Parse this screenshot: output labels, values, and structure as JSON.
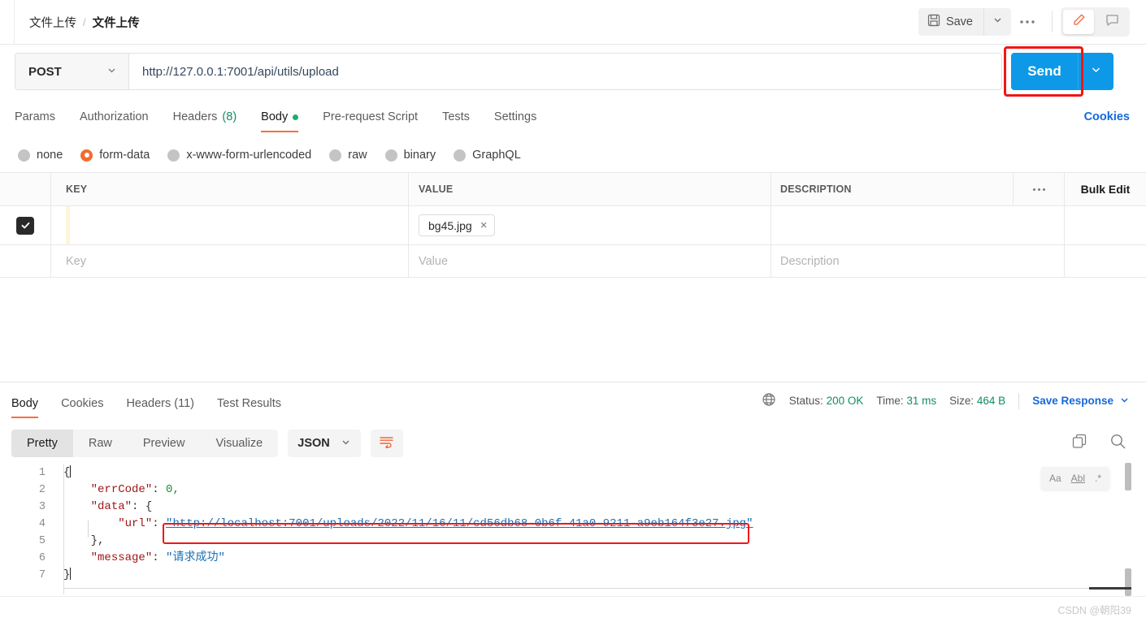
{
  "header": {
    "breadcrumb_parent": "文件上传",
    "breadcrumb_sep": "/",
    "breadcrumb_current": "文件上传",
    "save_label": "Save",
    "save_caret_icon": "chevron-down-icon",
    "save_icon": "floppy-disk-icon",
    "more_icon": "ooo",
    "edit_icon": "pencil-icon",
    "comment_icon": "comment-icon"
  },
  "request": {
    "method": "POST",
    "method_caret_icon": "chevron-down-icon",
    "url": "http://127.0.0.1:7001/api/utils/upload",
    "send_label": "Send",
    "send_caret_icon": "chevron-down-icon"
  },
  "request_tabs": [
    {
      "label": "Params",
      "active": false
    },
    {
      "label": "Authorization",
      "active": false
    },
    {
      "label": "Headers",
      "count": "(8)",
      "active": false
    },
    {
      "label": "Body",
      "dot": true,
      "active": true
    },
    {
      "label": "Pre-request Script",
      "active": false
    },
    {
      "label": "Tests",
      "active": false
    },
    {
      "label": "Settings",
      "active": false
    }
  ],
  "cookies_link": "Cookies",
  "body_types": [
    {
      "label": "none",
      "selected": false
    },
    {
      "label": "form-data",
      "selected": true
    },
    {
      "label": "x-www-form-urlencoded",
      "selected": false
    },
    {
      "label": "raw",
      "selected": false
    },
    {
      "label": "binary",
      "selected": false
    },
    {
      "label": "GraphQL",
      "selected": false
    }
  ],
  "kv_table": {
    "headers": {
      "key": "KEY",
      "value": "VALUE",
      "description": "DESCRIPTION"
    },
    "more_icon": "ooo",
    "bulk_edit": "Bulk Edit",
    "rows": [
      {
        "checked": true,
        "key": "",
        "value_chip": "bg45.jpg",
        "chip_close": "×",
        "description": ""
      }
    ],
    "placeholders": {
      "key": "Key",
      "value": "Value",
      "description": "Description"
    }
  },
  "response_tabs": [
    {
      "label": "Body",
      "active": true
    },
    {
      "label": "Cookies",
      "active": false
    },
    {
      "label": "Headers (11)",
      "active": false
    },
    {
      "label": "Test Results",
      "active": false
    }
  ],
  "response_meta": {
    "globe_icon": "globe-icon",
    "status_label": "Status:",
    "status_value": "200 OK",
    "time_label": "Time:",
    "time_value": "31 ms",
    "size_label": "Size:",
    "size_value": "464 B",
    "save_response": "Save Response",
    "save_response_caret": "chevron-down-icon"
  },
  "viewer": {
    "segments": [
      {
        "label": "Pretty",
        "active": true
      },
      {
        "label": "Raw",
        "active": false
      },
      {
        "label": "Preview",
        "active": false
      },
      {
        "label": "Visualize",
        "active": false
      }
    ],
    "format": "JSON",
    "format_caret_icon": "chevron-down-icon",
    "wrap_icon": "wrap-lines-icon",
    "copy_icon": "copy-icon",
    "search_icon": "search-icon",
    "find_options": [
      "Aa",
      "Abl",
      ".*"
    ]
  },
  "response_body": {
    "line_numbers": [
      "1",
      "2",
      "3",
      "4",
      "5",
      "6",
      "7"
    ],
    "json": {
      "errCode": "0",
      "url": "http://localhost:7001/uploads/2022/11/16/11/cd56db68-0b6f-41a0-9211-a9eb164f3e27.jpg",
      "message": "请求成功"
    },
    "tokens": {
      "open_brace": "{",
      "errCode_key": "\"errCode\"",
      "errCode_val": "0,",
      "data_key": "\"data\"",
      "data_open": "{",
      "url_key": "\"url\"",
      "url_val": "\"http://localhost:7001/uploads/2022/11/16/11/cd56db68-0b6f-41a0-9211-a9eb164f3e27.jpg\"",
      "data_close": "},",
      "message_key": "\"message\"",
      "message_val": "\"请求成功\"",
      "close_brace": "}",
      "colon": ": "
    }
  },
  "watermark": "CSDN @朝阳39",
  "colors": {
    "accent_orange": "#ff6c37",
    "send_blue": "#0d99e8",
    "link_blue": "#1668dc",
    "status_green": "#0f8f5f",
    "highlight_red": "#f41515"
  }
}
